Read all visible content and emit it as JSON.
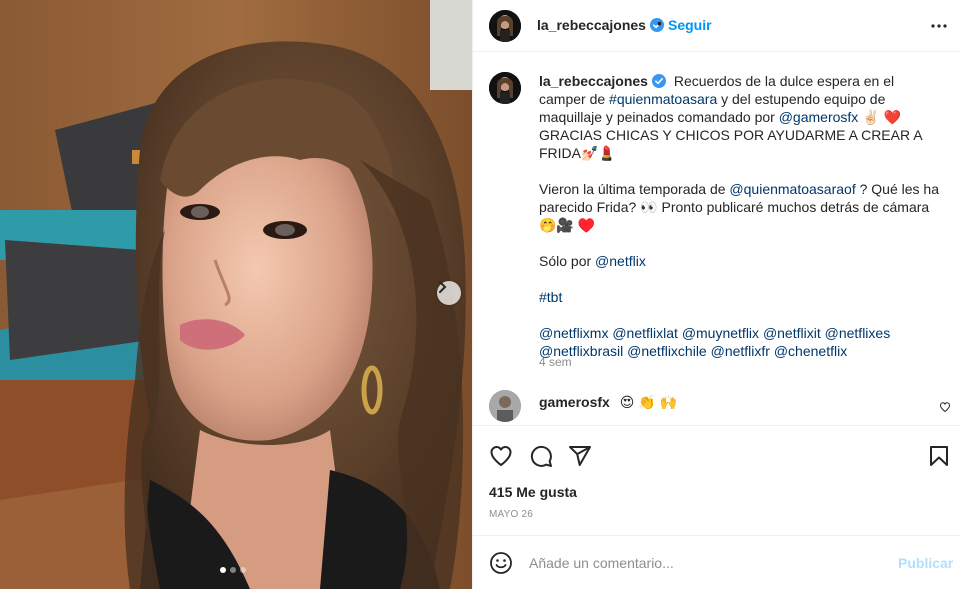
{
  "post": {
    "author": "la_rebeccajones",
    "follow_label": "Seguir",
    "header_dot": "•",
    "caption": {
      "line1_text": "Recuerdos de la dulce espera en el camper de",
      "tag_quienmatoasara": "#quienmatoasara",
      "line2_text": "y del estupendo equipo de maquillaje y peinados comandado por",
      "mention_gamerosfx": "@gamerosfx",
      "emoji_1": "✌🏻 ❤️",
      "line3_text": "GRACIAS CHICAS Y CHICOS POR AYUDARME A CREAR A FRIDA💅🏻💄",
      "para2_text": "Vieron la última temporada de",
      "mention_quienmatoasaraof": "@quienmatoasaraof",
      "para2_rest": "? Qué les ha parecido Frida? 👀 Pronto publicaré muchos detrás de cámara 🤭🎥 ♥️",
      "para3_text": "Sólo por",
      "mention_netflix": "@netflix",
      "hashtag_tbt": "#tbt",
      "mentions": [
        "@netflixmx",
        "@netflixlat",
        "@muynetflix",
        "@netflixit",
        "@netflixes",
        "@netflixbrasil",
        "@netflixchile",
        "@netflixfr",
        "@chenetflix"
      ]
    },
    "timestamp": "4 sem",
    "comment": {
      "user": "gamerosfx",
      "text": "😍 👏 🙌"
    },
    "likes": "415 Me gusta",
    "date": "MAYO 26",
    "add_comment_placeholder": "Añade un comentario...",
    "publish_label": "Publicar"
  },
  "icons": {
    "more": "more-options-icon",
    "verified": "verified-badge-icon",
    "like": "heart-icon",
    "comment": "comment-icon",
    "share": "share-icon",
    "save": "bookmark-icon",
    "emoji": "emoji-icon",
    "next": "chevron-right-icon"
  },
  "colors": {
    "link": "#00376b",
    "accent": "#0095f6",
    "verified": "#3897f0",
    "muted": "#8e8e8e"
  }
}
